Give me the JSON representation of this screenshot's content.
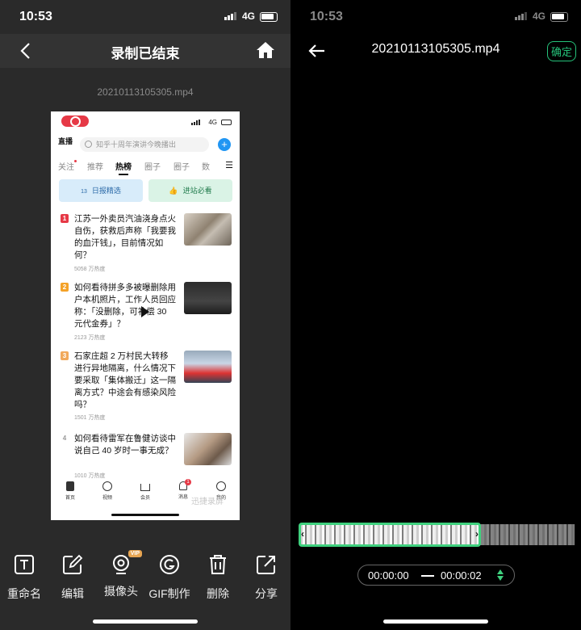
{
  "left": {
    "status": {
      "time": "10:53",
      "network": "4G"
    },
    "title": "录制已结束",
    "filename": "20210113105305.mp4",
    "tools": [
      {
        "id": "rename",
        "label": "重命名",
        "icon": "rename-icon"
      },
      {
        "id": "edit",
        "label": "编辑",
        "icon": "edit-icon"
      },
      {
        "id": "camera",
        "label": "摄像头",
        "icon": "camera-icon",
        "badge": "VIP"
      },
      {
        "id": "gif",
        "label": "GIF制作",
        "icon": "gif-icon"
      },
      {
        "id": "delete",
        "label": "删除",
        "icon": "trash-icon"
      },
      {
        "id": "share",
        "label": "分享",
        "icon": "share-icon"
      }
    ]
  },
  "right": {
    "status": {
      "time": "10:53",
      "network": "4G"
    },
    "title": "20210113105305.mp4",
    "confirm": "确定",
    "time_start": "00:00:00",
    "time_end": "00:00:02"
  },
  "video": {
    "network": "4G",
    "logo": "直播",
    "search_placeholder": "知乎十周年演讲今晚播出",
    "tabs": [
      "关注",
      "推荐",
      "热榜",
      "圈子",
      "数"
    ],
    "tab_label": "圈子",
    "tabs_full": [
      "关注",
      "推荐",
      "热榜",
      "圈子",
      "圈子",
      "数"
    ],
    "quick_buttons": [
      {
        "label": "日报精选",
        "badge": "13"
      },
      {
        "label": "进站必看"
      }
    ],
    "items": [
      {
        "rank": "1",
        "text": "江苏一外卖员汽油浇身点火自伤，获救后声称「我要我的血汗钱」，目前情况如何？",
        "heat": "5058 万热度"
      },
      {
        "rank": "2",
        "text": "如何看待拼多多被曝删除用户本机照片，工作人员回应称：「没删除，可补偿 30 元代金券」？",
        "heat": "2123 万热度"
      },
      {
        "rank": "3",
        "text": "石家庄超 2 万村民大转移进行异地隔离，什么情况下要采取「集体搬迁」这一隔离方式？中途会有感染风险吗？",
        "heat": "1501 万热度"
      },
      {
        "rank": "4",
        "text": "如何看待雷军在鲁健访谈中说自己 40 岁时一事无成？",
        "heat": "1010 万热度"
      }
    ],
    "nav": [
      "首页",
      "视频",
      "会员",
      "消息",
      "我的"
    ],
    "nav_badge": "1",
    "watermark": "迅捷录屏"
  },
  "colors": {
    "accent_green": "#3fd17e",
    "danger_red": "#e63946"
  }
}
